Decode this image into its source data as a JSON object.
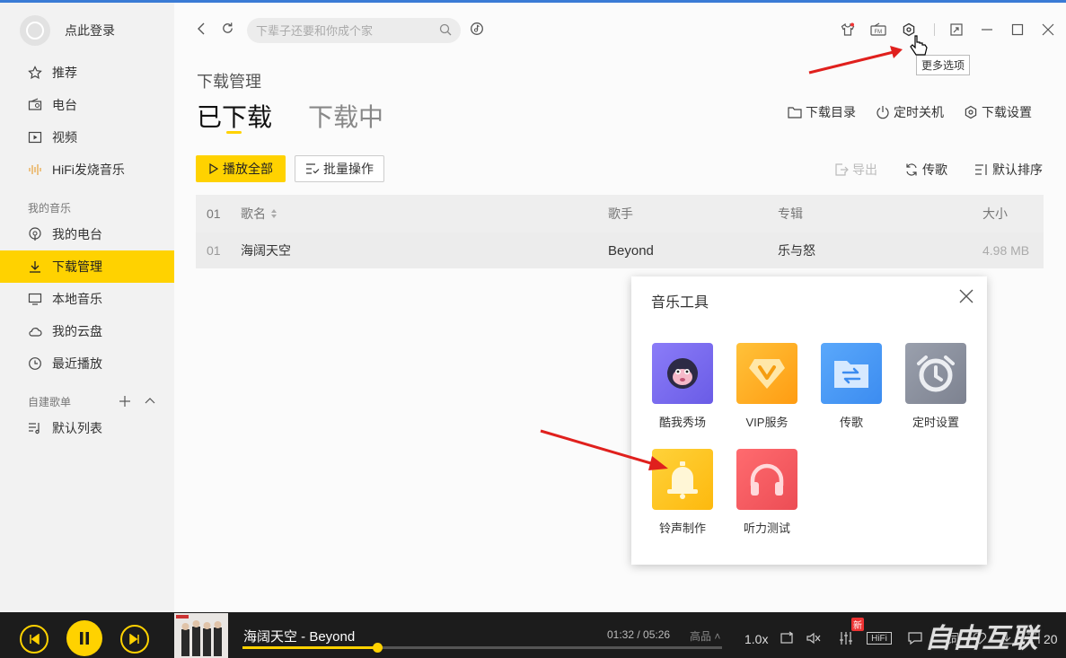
{
  "user": {
    "login_label": "点此登录"
  },
  "sidebar": {
    "main_items": [
      {
        "label": "推荐",
        "icon": "star-icon"
      },
      {
        "label": "电台",
        "icon": "radio-icon"
      },
      {
        "label": "视频",
        "icon": "video-icon"
      },
      {
        "label": "HiFi发烧音乐",
        "icon": "soundwave-icon"
      }
    ],
    "my_music_label": "我的音乐",
    "my_music_items": [
      {
        "label": "我的电台",
        "icon": "podcast-icon"
      },
      {
        "label": "下载管理",
        "icon": "download-icon",
        "active": true
      },
      {
        "label": "本地音乐",
        "icon": "monitor-icon"
      },
      {
        "label": "我的云盘",
        "icon": "cloud-icon"
      },
      {
        "label": "最近播放",
        "icon": "clock-icon"
      }
    ],
    "playlists_label": "自建歌单",
    "playlist_items": [
      {
        "label": "默认列表",
        "icon": "playlist-icon"
      }
    ]
  },
  "search": {
    "placeholder": "下辈子还要和你成个家"
  },
  "topbar": {
    "tooltip": "更多选项"
  },
  "page": {
    "title": "下载管理",
    "tab_done": "已下载",
    "tab_downloading": "下载中",
    "links": [
      "下载目录",
      "定时关机",
      "下载设置"
    ],
    "play_all": "播放全部",
    "batch": "批量操作",
    "export": "导出",
    "transfer": "传歌",
    "sort": "默认排序"
  },
  "table": {
    "headers": {
      "index": "01",
      "name": "歌名",
      "artist": "歌手",
      "album": "专辑",
      "size": "大小"
    },
    "rows": [
      {
        "index": "01",
        "name": "海阔天空",
        "artist": "Beyond",
        "album": "乐与怒",
        "size": "4.98 MB"
      }
    ]
  },
  "popup": {
    "title": "音乐工具",
    "tools": [
      {
        "label": "酷我秀场",
        "color": "#7b6cf6"
      },
      {
        "label": "VIP服务",
        "color": "#ffb21e"
      },
      {
        "label": "传歌",
        "color": "#4a9af5"
      },
      {
        "label": "定时设置",
        "color": "#8a8f9c"
      },
      {
        "label": "铃声制作",
        "color": "#ffc61a"
      },
      {
        "label": "听力测试",
        "color": "#f2585f"
      }
    ]
  },
  "player": {
    "song": "海阔天空  - Beyond",
    "time": "01:32 / 05:26",
    "quality": "高品",
    "progress": 0.28,
    "speed": "1.0x",
    "new_badge": "新",
    "hifi": "HiFi",
    "lyric": "词",
    "count": "20",
    "watermark": "自由互联",
    "accent": "#ffd200"
  }
}
